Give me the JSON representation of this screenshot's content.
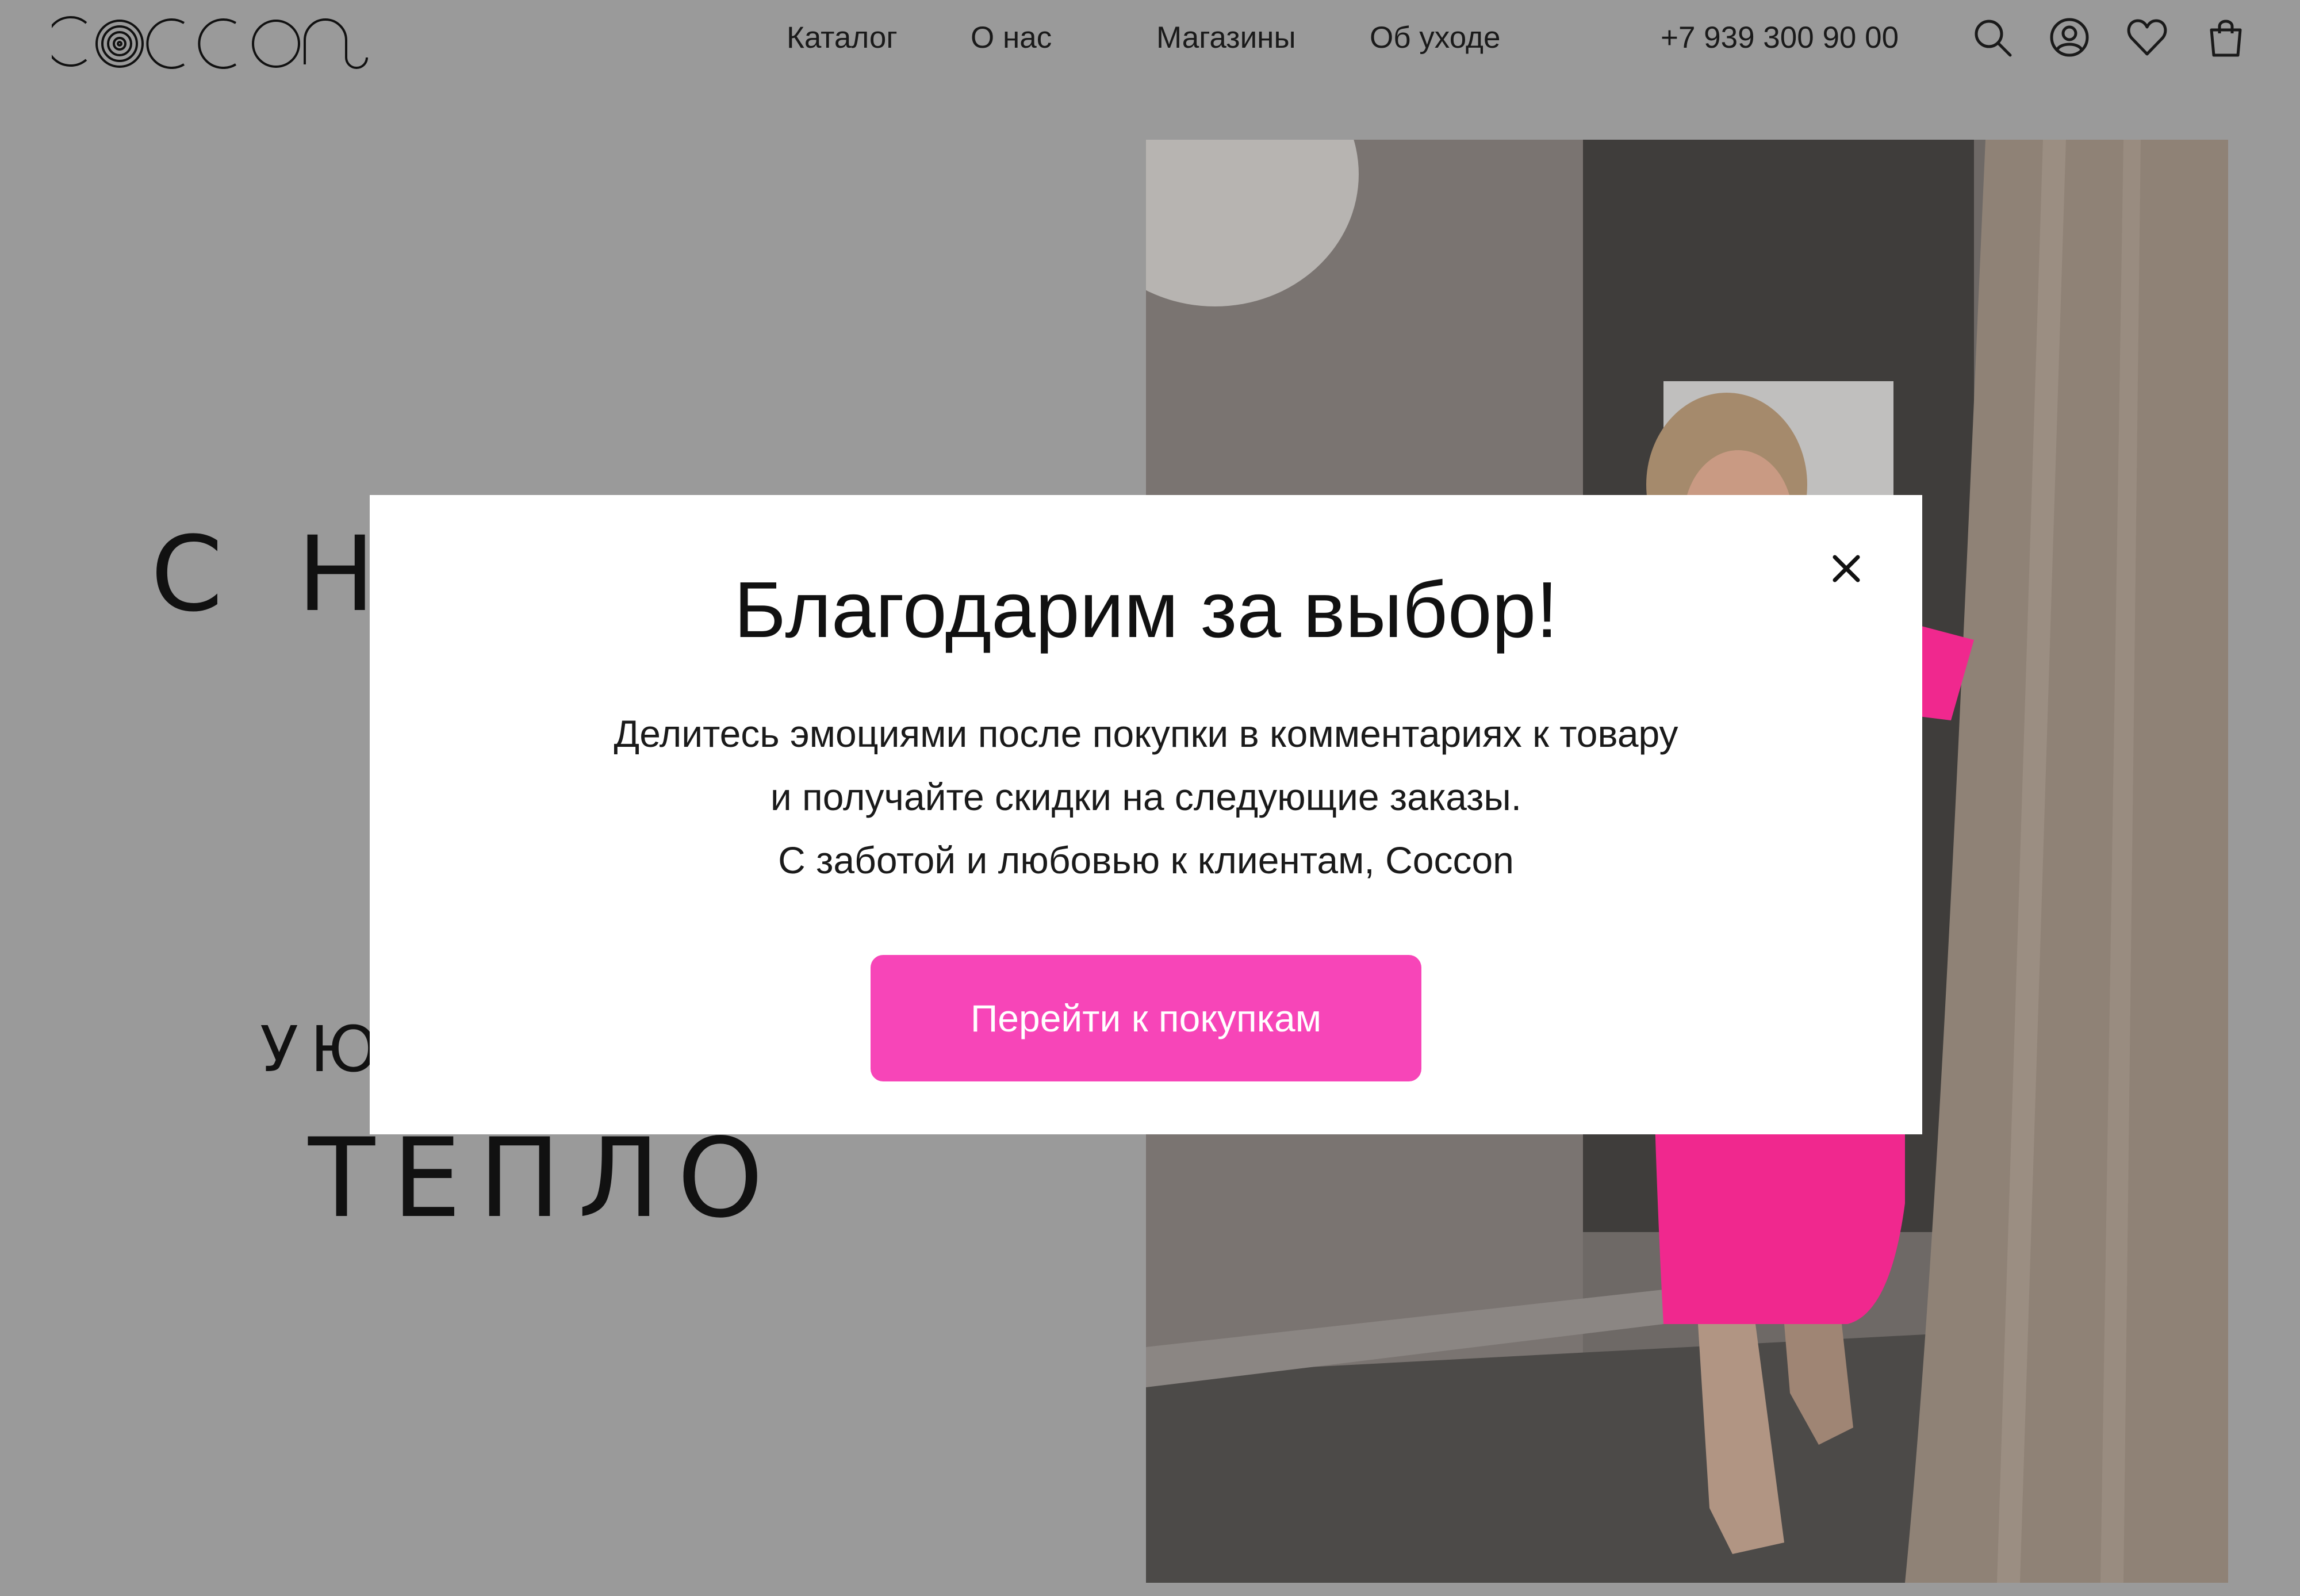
{
  "header": {
    "logo_name": "Coccon",
    "nav": [
      {
        "label": "Каталог"
      },
      {
        "label": "О нас"
      },
      {
        "label": "Магазины"
      },
      {
        "label": "Об уходе"
      }
    ],
    "phone": "+7 939 300 90 00",
    "icons": [
      "search-icon",
      "account-icon",
      "heart-icon",
      "bag-icon"
    ]
  },
  "hero": {
    "line1": "С НА",
    "line2": "УЮ",
    "line3": "ТЕПЛО",
    "photo": "woman-in-pink-knit-dress"
  },
  "modal": {
    "title": "Благодарим за выбор!",
    "line1": "Делитесь эмоциями после покупки в комментариях к товару",
    "line2": "и получайте скидки на следующие заказы.",
    "line3": "С заботой и любовью к клиентам, Coccon",
    "button_label": "Перейти к покупкам",
    "close_icon": "close-icon"
  },
  "colors": {
    "overlay_background": "#9a9a9a",
    "accent": "#f745b8",
    "modal_background": "#ffffff",
    "text": "#111111"
  }
}
